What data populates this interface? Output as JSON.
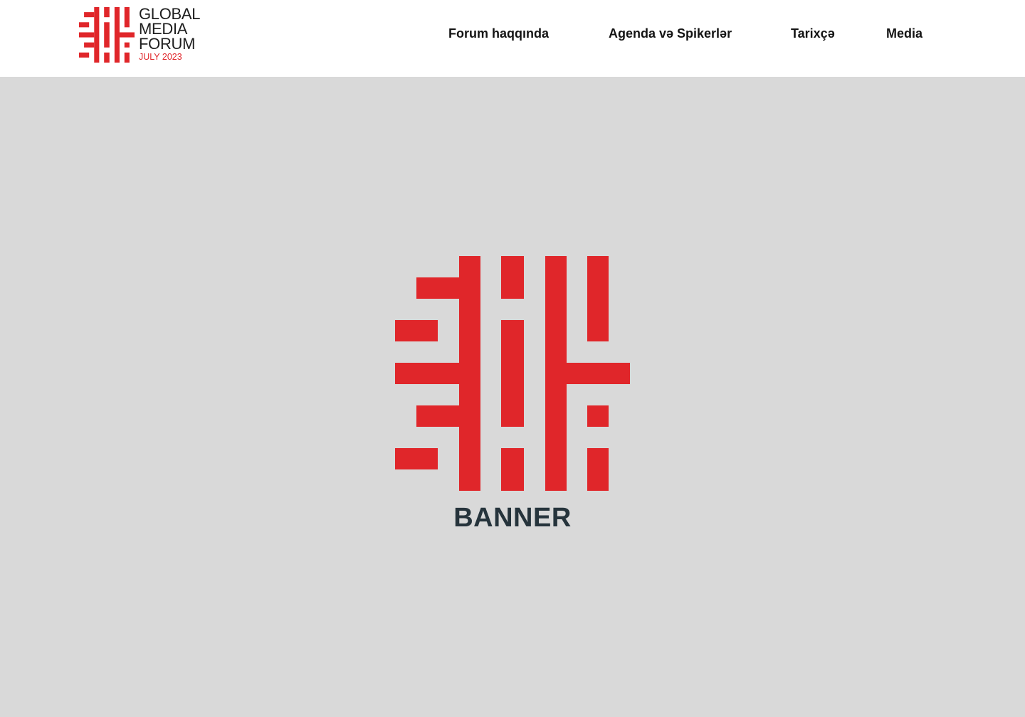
{
  "colors": {
    "brand_red": "#e0262a",
    "text_dark": "#141414",
    "banner_bg": "#d9d9d9",
    "banner_text": "#26343c"
  },
  "logo": {
    "icon": "global-media-forum-mark-icon",
    "line1": "GLOBAL",
    "line2": "MEDIA",
    "line3": "FORUM",
    "date": "JULY 2023"
  },
  "nav": {
    "items": [
      {
        "label": "Forum haqqında"
      },
      {
        "label": "Agenda və Spikerlər"
      },
      {
        "label": "Tarixçə"
      },
      {
        "label": "Media"
      }
    ]
  },
  "banner": {
    "icon": "global-media-forum-mark-icon",
    "label": "BANNER"
  }
}
